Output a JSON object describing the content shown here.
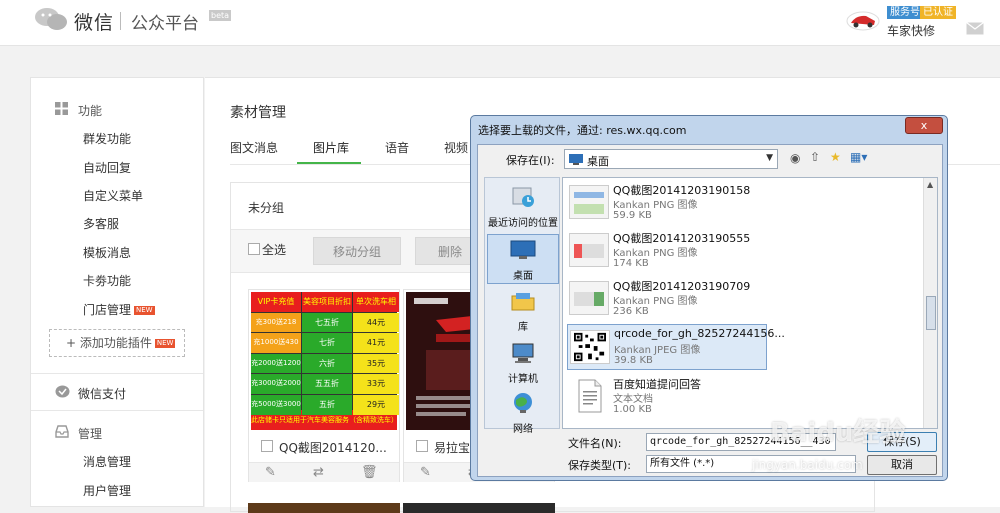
{
  "header": {
    "app_name": "微信",
    "app_sub": "公众平台",
    "beta": "beta",
    "badge_service": "服务号",
    "badge_verified": "已认证",
    "account_name": "车家快修"
  },
  "sidebar": {
    "groups": [
      {
        "label": "功能",
        "items": [
          "群发功能",
          "自动回复",
          "自定义菜单",
          "多客服",
          "模板消息",
          "卡劵功能",
          "门店管理"
        ]
      },
      {
        "label": "微信支付"
      },
      {
        "label": "管理",
        "items": [
          "消息管理",
          "用户管理"
        ]
      }
    ],
    "new_tag": "NEW",
    "add_plugin": "添加功能插件"
  },
  "main": {
    "title": "素材管理",
    "tabs": [
      "图文消息",
      "图片库",
      "语音",
      "视频"
    ],
    "active_tab": "图片库",
    "group_name": "未分组",
    "select_all": "全选",
    "move_group": "移动分组",
    "delete": "删除",
    "cards": [
      {
        "name": "QQ截图2014120..."
      },
      {
        "name": "易拉宝1..."
      }
    ],
    "poster1": {
      "rows": [
        [
          "VIP卡充值",
          "美容项目折扣率",
          "单次洗车相当于"
        ],
        [
          "充300送218",
          "七五折",
          "44元"
        ],
        [
          "充1000送430",
          "七折",
          "41元"
        ],
        [
          "充2000送1200",
          "六折",
          "35元"
        ],
        [
          "充3000送2000",
          "五五折",
          "33元"
        ],
        [
          "充5000送3000",
          "五折",
          "29元"
        ]
      ],
      "footer": "此店储卡只适用于汽车美容服务（含精致洗车）"
    }
  },
  "dialog": {
    "title": "选择要上载的文件，通过: res.wx.qq.com",
    "close": "x",
    "save_in_label": "保存在(I):",
    "save_in_value": "桌面",
    "places": [
      {
        "label": "最近访问的位置",
        "icon": "recent-places-icon"
      },
      {
        "label": "桌面",
        "icon": "desktop-icon"
      },
      {
        "label": "库",
        "icon": "libraries-icon"
      },
      {
        "label": "计算机",
        "icon": "computer-icon"
      },
      {
        "label": "网络",
        "icon": "network-icon"
      }
    ],
    "files": [
      {
        "name": "QQ截图20141203190158",
        "type": "Kankan PNG 图像",
        "size": "59.9 KB"
      },
      {
        "name": "QQ截图20141203190555",
        "type": "Kankan PNG 图像",
        "size": "174 KB"
      },
      {
        "name": "QQ截图20141203190709",
        "type": "Kankan PNG 图像",
        "size": "236 KB"
      },
      {
        "name": "qrcode_for_gh_82527244156...",
        "type": "Kankan JPEG 图像",
        "size": "39.8 KB"
      },
      {
        "name": "百度知道提问回答",
        "type": "文本文档",
        "size": "1.00 KB"
      }
    ],
    "filename_label": "文件名(N):",
    "filename_value": "qrcode_for_gh_82527244156__430",
    "filetype_label": "保存类型(T):",
    "filetype_value": "所有文件 (*.*)",
    "save_btn": "保存(S)",
    "cancel_btn": "取消"
  },
  "watermark": {
    "brand": "Baidu经验",
    "url": "jingyan.baidu.com"
  },
  "colors": {
    "accent_green": "#44b549",
    "badge_blue": "#3e8ed0",
    "badge_orange": "#f0b428"
  }
}
